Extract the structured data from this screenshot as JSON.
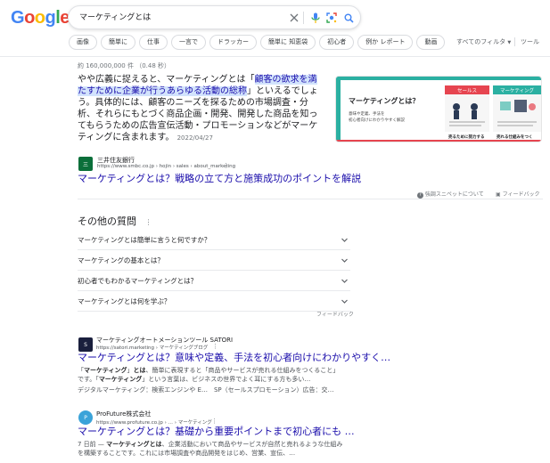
{
  "header": {
    "logo_letters": [
      {
        "ch": "G",
        "color": "#4285F4"
      },
      {
        "ch": "o",
        "color": "#EA4335"
      },
      {
        "ch": "o",
        "color": "#FBBC05"
      },
      {
        "ch": "g",
        "color": "#4285F4"
      },
      {
        "ch": "l",
        "color": "#34A853"
      },
      {
        "ch": "e",
        "color": "#EA4335"
      }
    ],
    "search_query": "マーケティングとは",
    "icons": [
      "clear-icon",
      "microphone-icon",
      "lens-icon",
      "search-icon"
    ]
  },
  "chips": [
    "画像",
    "簡単に",
    "仕事",
    "一言で",
    "ドラッカー",
    "簡単に 知恵袋",
    "初心者",
    "例か レポート",
    "動画"
  ],
  "tools": {
    "filters": "すべてのフィルタ",
    "tools": "ツール"
  },
  "stats": "約 160,000,000 件 （0.48 秒）",
  "featured": {
    "snippet_lead": "やや広義に捉えると、マーケティングとは「",
    "snippet_highlight": "顧客の欲求を満たすために企業が行うあらゆる活動の総称",
    "snippet_rest": "」といえるでしょう。具体的には、顧客のニーズを探るための市場調査・分析、それらにもとづく商品企画・開発、開発した商品を知ってもらうための広告宣伝活動・プロモーションなどがマーケティングに含まれます。",
    "date": "2022/04/27",
    "source_name": "三井住友銀行",
    "source_url": "https://www.smbc.co.jp › hojin › sales › about_marketing",
    "title": "マーケティングとは？戦略の立て方と施策成功のポイントを解説",
    "image": {
      "heading": "マーケティングとは？",
      "sub1": "意味や定義、手法を",
      "sub2": "初心者向けにわかりやすく解説",
      "sales_label": "セールス",
      "marketing_label": "マーケティング",
      "sales_caption": "売るために努力する",
      "marketing_caption": "売れる仕組みをつく",
      "brand_color": "#2bb0a2",
      "accent_color": "#e64550"
    },
    "about_snippets": "強調スニペットについて",
    "feedback": "フィードバック"
  },
  "paa": {
    "title": "その他の質問",
    "questions": [
      "マーケティングとは簡単に言うと何ですか？",
      "マーケティングの基本とは？",
      "初心者でもわかるマーケティングとは？",
      "マーケティングとは何を学ぶ？"
    ],
    "feedback": "フィードバック"
  },
  "results": [
    {
      "source_name": "マーケティングオートメーションツール SATORI",
      "source_url": "https://satori.marketing › マーケティングブログ",
      "title": "マーケティングとは？意味や定義、手法を初心者向けにわかりやすく…",
      "snip1_lead": "「",
      "snip1_bold": "マーケティング",
      "snip1_mid": "」",
      "snip1_bold2": "とは",
      "snip1_rest": "、簡単に表現すると「商品やサービスが売れる仕組みをつくること」",
      "snip2_lead": "です。「",
      "snip2_bold": "マーケティング",
      "snip2_rest": "」という言葉は、ビジネスの世界でよく耳にする方も多い…",
      "snip3": "デジタルマーケティング：検索エンジンや E…　SP（セールスプロモーション）広告：交…"
    },
    {
      "source_name": "ProFuture株式会社",
      "source_url": "https://www.profuture.co.jp › … › マーケティング",
      "title": "マーケティングとは？基礎から重要ポイントまで初心者にも …",
      "snip1_lead": "7 日前 — ",
      "snip1_bold": "マーケティングとは",
      "snip1_rest": "、企業活動において商品やサービスが自然と売れるような仕組み",
      "snip2": "を構築することです。これには市場調査や商品開発をはじめ、営業、宣伝、…"
    }
  ]
}
